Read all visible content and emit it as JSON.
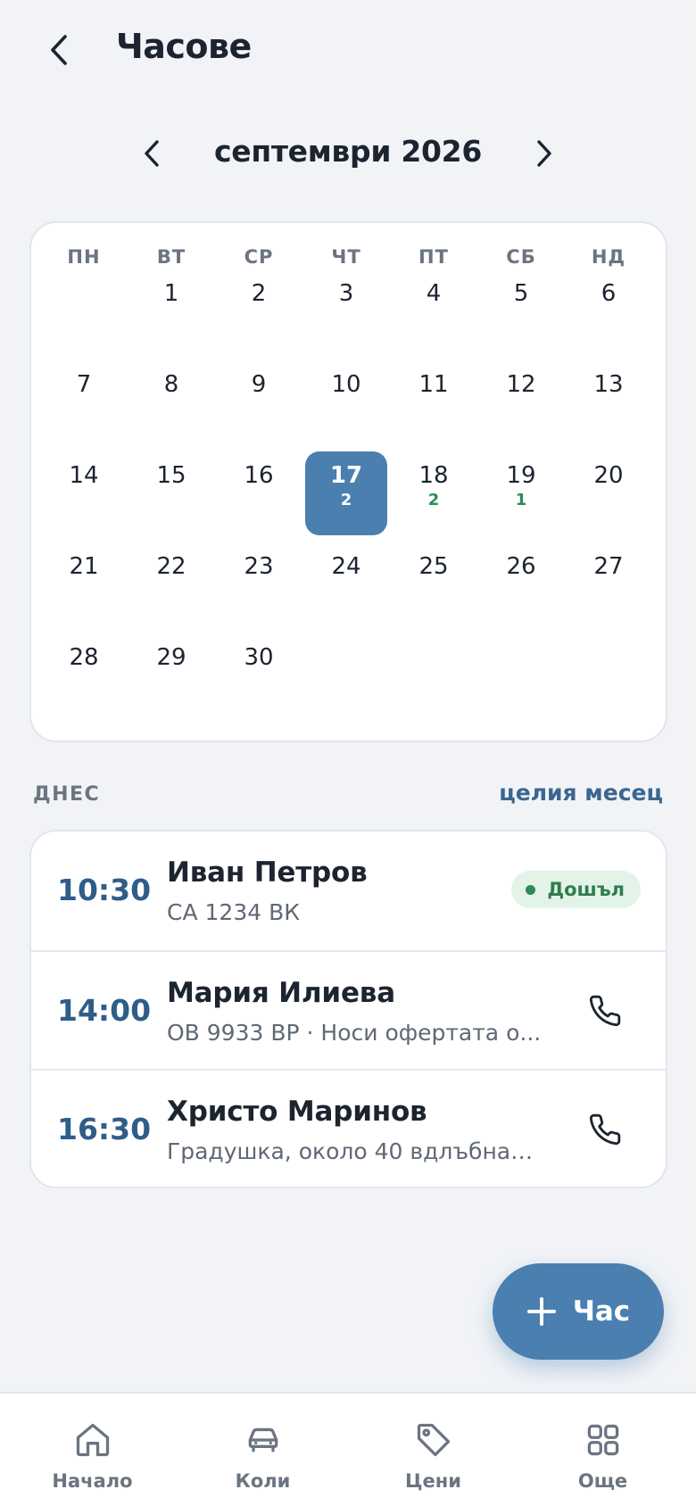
{
  "header": {
    "title": "Часове",
    "back_icon": "chevron-left-icon"
  },
  "calendar": {
    "month_label": "септември 2026",
    "weekdays": [
      "ПН",
      "ВТ",
      "СР",
      "ЧТ",
      "ПТ",
      "СБ",
      "НД"
    ],
    "days": [
      {
        "n": "1"
      },
      {
        "n": "2"
      },
      {
        "n": "3"
      },
      {
        "n": "4"
      },
      {
        "n": "5"
      },
      {
        "n": "6"
      },
      {
        "n": "7"
      },
      {
        "n": "8"
      },
      {
        "n": "9"
      },
      {
        "n": "10"
      },
      {
        "n": "11"
      },
      {
        "n": "12"
      },
      {
        "n": "13"
      },
      {
        "n": "14"
      },
      {
        "n": "15"
      },
      {
        "n": "16"
      },
      {
        "n": "17",
        "count": "2",
        "selected": true
      },
      {
        "n": "18",
        "count": "2"
      },
      {
        "n": "19",
        "count": "1"
      },
      {
        "n": "20"
      },
      {
        "n": "21"
      },
      {
        "n": "22"
      },
      {
        "n": "23"
      },
      {
        "n": "24"
      },
      {
        "n": "25"
      },
      {
        "n": "26"
      },
      {
        "n": "27"
      },
      {
        "n": "28"
      },
      {
        "n": "29"
      },
      {
        "n": "30"
      }
    ],
    "first_weekday_index": 1,
    "accent_color": "#4a7fb0",
    "count_color": "#2e8b57"
  },
  "today": {
    "section_label": "ДНЕС",
    "month_link": "целия месец",
    "appointments": [
      {
        "time": "10:30",
        "name": "Иван Петров",
        "sub": "СА 1234 ВК",
        "status": "Дошъл"
      },
      {
        "time": "14:00",
        "name": "Мария Илиева",
        "sub": "ОВ 9933 ВР · Носи офертата о...",
        "action_icon": "phone-icon"
      },
      {
        "time": "16:30",
        "name": "Христо Маринов",
        "sub": "Градушка, около 40 вдлъбнат...",
        "action_icon": "phone-icon"
      }
    ]
  },
  "fab": {
    "label": "Час",
    "icon": "plus-icon"
  },
  "bottom_nav": {
    "items": [
      {
        "label": "Начало",
        "icon": "home-icon"
      },
      {
        "label": "Коли",
        "icon": "car-icon"
      },
      {
        "label": "Цени",
        "icon": "tag-icon"
      },
      {
        "label": "Още",
        "icon": "grid-icon"
      }
    ]
  }
}
